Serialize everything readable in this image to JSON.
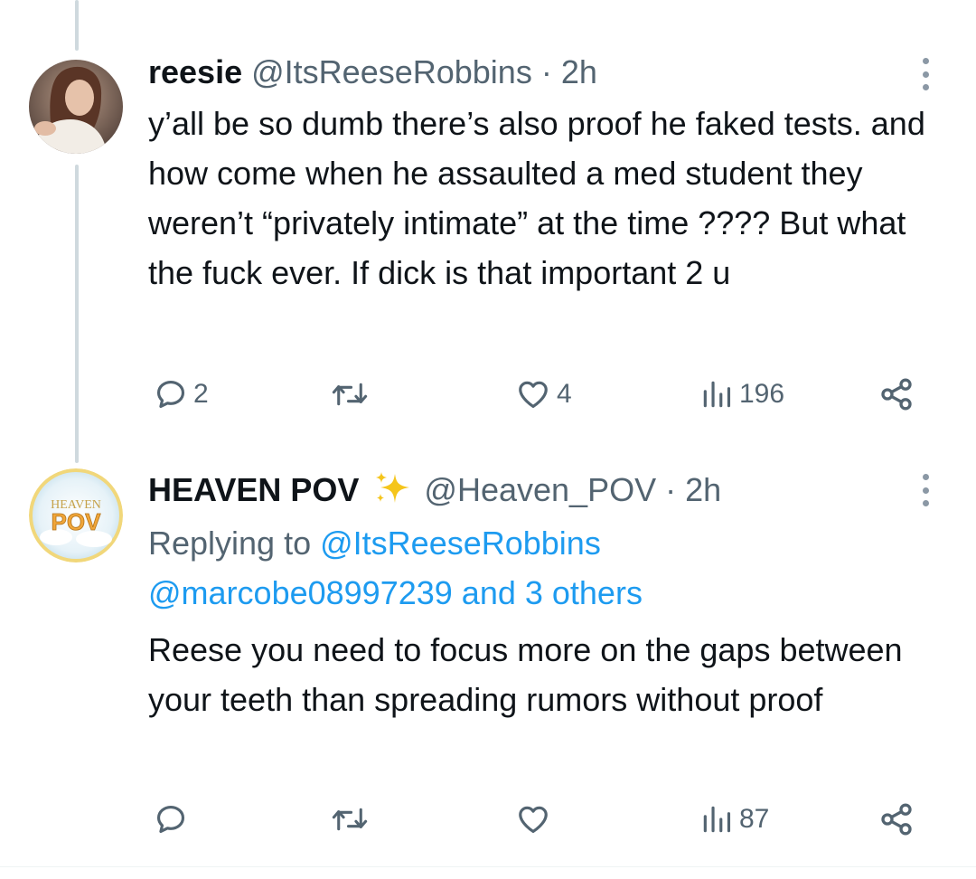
{
  "tweets": [
    {
      "display_name": "reesie",
      "handle": "@ItsReeseRobbins",
      "separator": "·",
      "time": "2h",
      "avatar_icon": "profile-photo",
      "body": "y’all be so dumb there’s also proof he faked tests. and how come when he assaulted a med student they weren’t “privately intimate” at the time ???? But what the fuck ever. If dick is that important 2 u",
      "actions": {
        "reply_count": "2",
        "retweet_count": "",
        "like_count": "4",
        "view_count": "196"
      }
    },
    {
      "display_name": "HEAVEN POV",
      "name_emoji": "sparkles-emoji",
      "handle": "@Heaven_POV",
      "separator": "·",
      "time": "2h",
      "avatar_logo_text": [
        "HEAVEN",
        "POV"
      ],
      "replying_to_label": "Replying to",
      "replying_to_user": "@ItsReeseRobbins",
      "replying_to_user2": "@marcobe08997239",
      "replying_to_others": "and 3 others",
      "body": "Reese you need to focus more on the gaps between your teeth than spreading rumors without proof",
      "actions": {
        "reply_count": "",
        "retweet_count": "",
        "like_count": "",
        "view_count": "87"
      }
    }
  ],
  "colors": {
    "text": "#0f1419",
    "secondary": "#536471",
    "link": "#1d9bf0",
    "thread_line": "#cfd9de"
  }
}
